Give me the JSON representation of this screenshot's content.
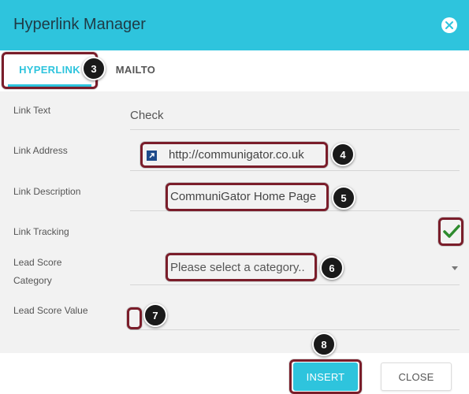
{
  "dialog": {
    "title": "Hyperlink Manager"
  },
  "tabs": [
    {
      "label": "HYPERLINK",
      "active": true
    },
    {
      "label": "MAILTO",
      "active": false
    }
  ],
  "form": {
    "link_text": {
      "label": "Link Text",
      "value": "Check"
    },
    "link_address": {
      "label": "Link Address",
      "value": "http://communigator.co.uk"
    },
    "link_description": {
      "label": "Link Description",
      "value": "CommuniGator Home Page"
    },
    "link_tracking": {
      "label": "Link Tracking",
      "checked": true
    },
    "lead_score_category": {
      "label_line1": "Lead Score",
      "label_line2": "Category",
      "placeholder": "Please select a category.."
    },
    "lead_score_value": {
      "label": "Lead Score Value",
      "value": ""
    }
  },
  "badges": {
    "b3": "3",
    "b4": "4",
    "b5": "5",
    "b6": "6",
    "b7": "7",
    "b8": "8"
  },
  "footer": {
    "insert_label": "INSERT",
    "close_label": "CLOSE"
  },
  "colors": {
    "accent": "#2ec4dd",
    "highlight_border": "#7a1d2a",
    "check": "#2e8b2e",
    "link_icon": "#1d4a8a"
  },
  "icons": {
    "close": "close-icon",
    "link": "external-link-icon",
    "check": "checkmark-icon",
    "dropdown": "chevron-down-icon"
  }
}
